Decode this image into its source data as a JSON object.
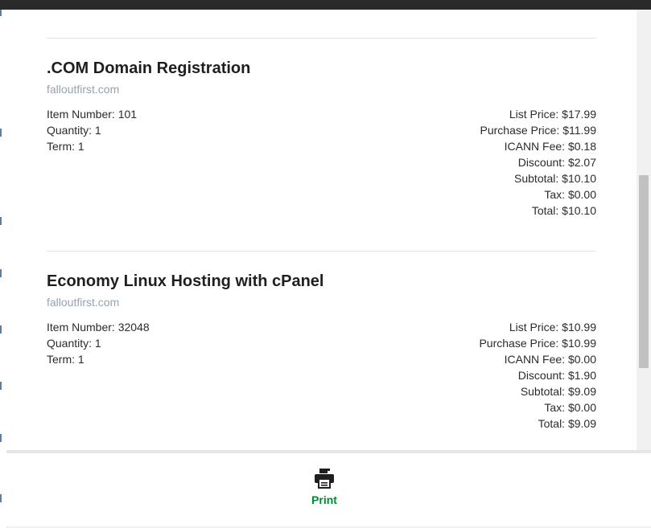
{
  "items": [
    {
      "title": ".COM Domain Registration",
      "domain": "falloutfirst.com",
      "item_number": "Item Number: 101",
      "quantity": "Quantity: 1",
      "term": "Term: 1",
      "list_price": "List Price: $17.99",
      "purchase_price": "Purchase Price: $11.99",
      "icann_fee": "ICANN Fee: $0.18",
      "discount": "Discount: $2.07",
      "subtotal": "Subtotal: $10.10",
      "tax": "Tax: $0.00",
      "total": "Total: $10.10"
    },
    {
      "title": "Economy Linux Hosting with cPanel",
      "domain": "falloutfirst.com",
      "item_number": "Item Number: 32048",
      "quantity": "Quantity: 1",
      "term": "Term: 1",
      "list_price": "List Price: $10.99",
      "purchase_price": "Purchase Price: $10.99",
      "icann_fee": "ICANN Fee: $0.00",
      "discount": "Discount: $1.90",
      "subtotal": "Subtotal: $9.09",
      "tax": "Tax: $0.00",
      "total": "Total: $9.09"
    }
  ],
  "footer": {
    "print_label": "Print",
    "print_icon": "printer-icon"
  },
  "colors": {
    "topbar": "#2a2a2a",
    "domain_text": "#95a3b0",
    "print_green": "#008a32"
  }
}
